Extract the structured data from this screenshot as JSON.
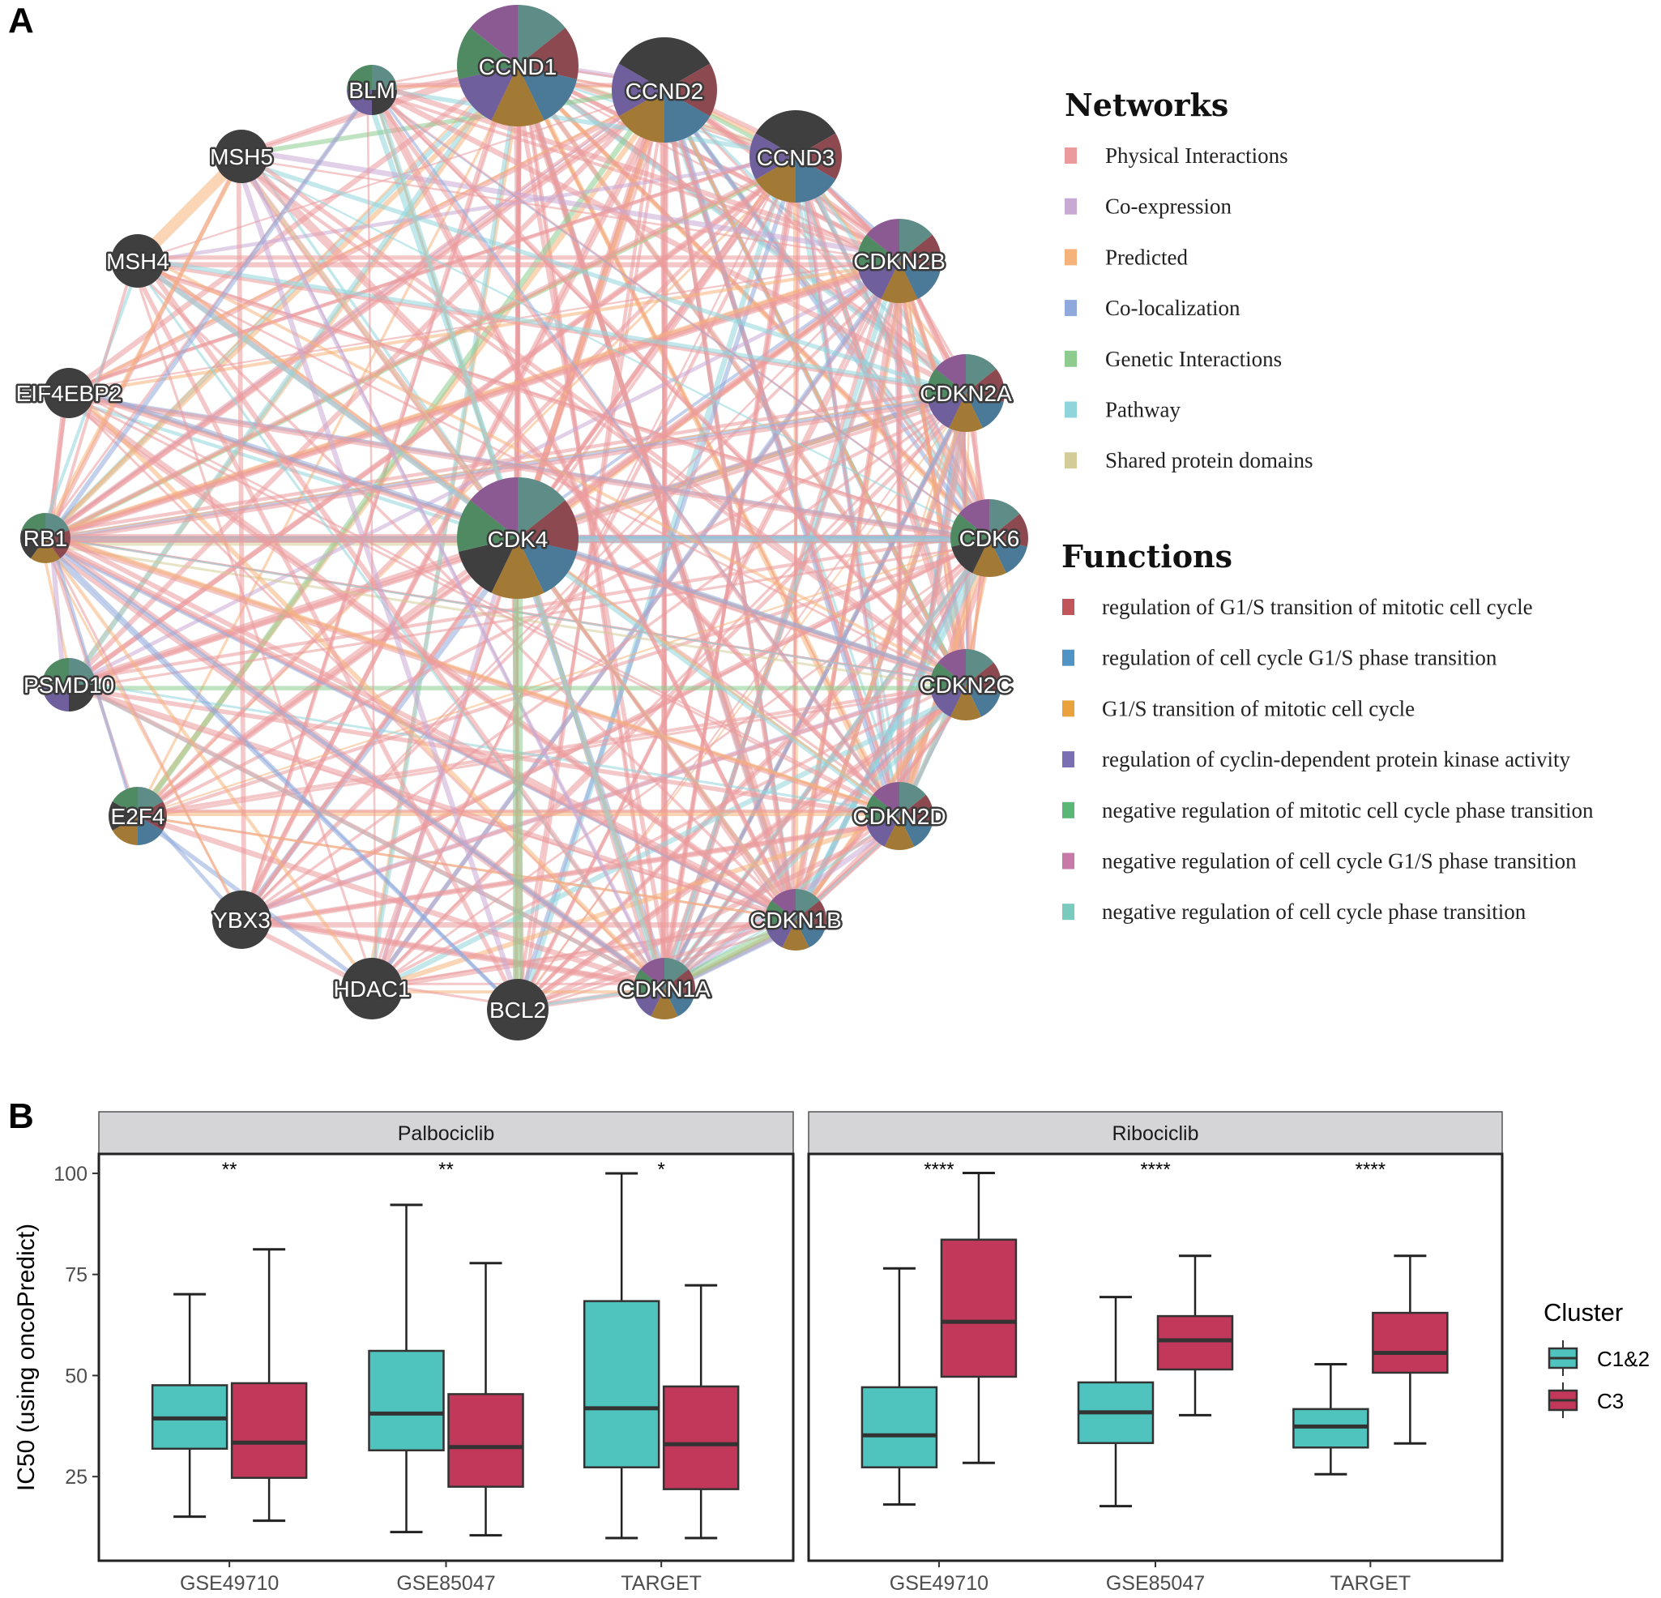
{
  "panel_a": {
    "letter": "A",
    "networks_legend": {
      "title": "Networks",
      "items": [
        {
          "label": "Physical Interactions",
          "color": "#eb9a9c"
        },
        {
          "label": "Co-expression",
          "color": "#c8a9d4"
        },
        {
          "label": "Predicted",
          "color": "#f5b27a"
        },
        {
          "label": "Co-localization",
          "color": "#90a9dc"
        },
        {
          "label": "Genetic Interactions",
          "color": "#8dcc8e"
        },
        {
          "label": "Pathway",
          "color": "#8fd6dc"
        },
        {
          "label": "Shared protein domains",
          "color": "#d4cc98"
        }
      ]
    },
    "functions_legend": {
      "title": "Functions",
      "items": [
        {
          "label": "regulation of G1/S transition of mitotic cell cycle",
          "color": "#c0565a"
        },
        {
          "label": "regulation of cell cycle G1/S phase transition",
          "color": "#4f94c4"
        },
        {
          "label": "G1/S transition of mitotic cell cycle",
          "color": "#eaa23c"
        },
        {
          "label": "regulation of cyclin-dependent protein kinase activity",
          "color": "#7a6fb3"
        },
        {
          "label": "negative regulation of mitotic cell cycle phase transition",
          "color": "#5bb776"
        },
        {
          "label": "negative regulation of cell cycle G1/S phase transition",
          "color": "#c77aa8"
        },
        {
          "label": "negative regulation of cell cycle phase transition",
          "color": "#79cbbe"
        }
      ]
    },
    "pie_colors": {
      "teal": "#5e8c86",
      "maroon": "#8c4a50",
      "blue": "#4a7a98",
      "gold": "#a37a35",
      "purple": "#6f5f9c",
      "green": "#4f8a63",
      "magenta": "#8c5a92",
      "dark": "#3f3f3f"
    },
    "nodes": [
      {
        "id": "CDK4",
        "slices": [
          "teal",
          "maroon",
          "blue",
          "gold",
          "dark",
          "green",
          "magenta"
        ],
        "center": true
      },
      {
        "id": "CCND1",
        "slices": [
          "teal",
          "maroon",
          "blue",
          "gold",
          "purple",
          "green",
          "magenta"
        ]
      },
      {
        "id": "CCND2",
        "slices": [
          "dark",
          "maroon",
          "blue",
          "gold",
          "purple",
          "dark"
        ]
      },
      {
        "id": "CCND3",
        "slices": [
          "dark",
          "maroon",
          "blue",
          "gold",
          "purple",
          "dark"
        ]
      },
      {
        "id": "CDKN2B",
        "slices": [
          "teal",
          "maroon",
          "blue",
          "gold",
          "purple",
          "green",
          "magenta"
        ]
      },
      {
        "id": "CDKN2A",
        "slices": [
          "teal",
          "maroon",
          "blue",
          "gold",
          "purple",
          "green",
          "magenta"
        ]
      },
      {
        "id": "CDK6",
        "slices": [
          "teal",
          "maroon",
          "blue",
          "gold",
          "dark",
          "green",
          "magenta"
        ]
      },
      {
        "id": "CDKN2C",
        "slices": [
          "teal",
          "maroon",
          "blue",
          "gold",
          "purple",
          "green",
          "magenta"
        ]
      },
      {
        "id": "CDKN2D",
        "slices": [
          "teal",
          "maroon",
          "blue",
          "gold",
          "purple",
          "green",
          "magenta"
        ]
      },
      {
        "id": "CDKN1B",
        "slices": [
          "teal",
          "maroon",
          "blue",
          "gold",
          "purple",
          "green",
          "magenta"
        ]
      },
      {
        "id": "CDKN1A",
        "slices": [
          "teal",
          "maroon",
          "blue",
          "gold",
          "purple",
          "green",
          "magenta"
        ]
      },
      {
        "id": "BCL2",
        "slices": [
          "dark"
        ]
      },
      {
        "id": "HDAC1",
        "slices": [
          "dark"
        ]
      },
      {
        "id": "YBX3",
        "slices": [
          "dark"
        ]
      },
      {
        "id": "E2F4",
        "slices": [
          "teal",
          "maroon",
          "blue",
          "gold",
          "dark",
          "green"
        ]
      },
      {
        "id": "PSMD10",
        "slices": [
          "teal",
          "dark",
          "purple",
          "green"
        ]
      },
      {
        "id": "RB1",
        "slices": [
          "teal",
          "maroon",
          "gold",
          "dark",
          "green"
        ]
      },
      {
        "id": "EIF4EBP2",
        "slices": [
          "dark"
        ]
      },
      {
        "id": "MSH4",
        "slices": [
          "dark"
        ]
      },
      {
        "id": "MSH5",
        "slices": [
          "dark"
        ]
      },
      {
        "id": "BLM",
        "slices": [
          "teal",
          "dark",
          "purple",
          "green"
        ]
      }
    ]
  },
  "panel_b": {
    "letter": "B"
  },
  "chart_data": {
    "type": "boxplot",
    "title": "",
    "ylabel": "IC50 (using oncoPredict)",
    "xlabel": "",
    "ylim": [
      4.2,
      104.8
    ],
    "yticks": [
      25,
      50,
      75,
      100
    ],
    "categories": [
      "GSE49710",
      "GSE85047",
      "TARGET"
    ],
    "legend": {
      "title": "Cluster",
      "position": "right",
      "items": [
        {
          "name": "C1&2",
          "color": "#4fc4bf"
        },
        {
          "name": "C3",
          "color": "#c2385b"
        }
      ]
    },
    "facets": [
      {
        "label": "Palbociclib",
        "significance": [
          "**",
          "**",
          "*"
        ],
        "series": [
          {
            "name": "C1&2",
            "boxes": [
              {
                "min": 15.1,
                "q1": 31.9,
                "median": 39.4,
                "q3": 47.6,
                "max": 70.1
              },
              {
                "min": 11.3,
                "q1": 31.5,
                "median": 40.6,
                "q3": 56.1,
                "max": 92.2
              },
              {
                "min": 9.8,
                "q1": 27.3,
                "median": 41.9,
                "q3": 68.4,
                "max": 100.0
              }
            ]
          },
          {
            "name": "C3",
            "boxes": [
              {
                "min": 14.1,
                "q1": 24.7,
                "median": 33.4,
                "q3": 48.1,
                "max": 81.2
              },
              {
                "min": 10.5,
                "q1": 22.5,
                "median": 32.3,
                "q3": 45.4,
                "max": 77.8
              },
              {
                "min": 9.8,
                "q1": 21.9,
                "median": 33.0,
                "q3": 47.3,
                "max": 72.3
              }
            ]
          }
        ]
      },
      {
        "label": "Ribociclib",
        "significance": [
          "****",
          "****",
          "****"
        ],
        "series": [
          {
            "name": "C1&2",
            "boxes": [
              {
                "min": 18.1,
                "q1": 27.3,
                "median": 35.2,
                "q3": 47.1,
                "max": 76.5
              },
              {
                "min": 17.7,
                "q1": 33.3,
                "median": 40.9,
                "q3": 48.3,
                "max": 69.4
              },
              {
                "min": 25.6,
                "q1": 32.2,
                "median": 37.4,
                "q3": 41.7,
                "max": 52.8
              }
            ]
          },
          {
            "name": "C3",
            "boxes": [
              {
                "min": 28.4,
                "q1": 49.7,
                "median": 63.3,
                "q3": 83.6,
                "max": 100.1
              },
              {
                "min": 40.2,
                "q1": 51.5,
                "median": 58.7,
                "q3": 64.7,
                "max": 79.6
              },
              {
                "min": 33.2,
                "q1": 50.7,
                "median": 55.6,
                "q3": 65.5,
                "max": 79.6
              }
            ]
          }
        ]
      }
    ]
  }
}
